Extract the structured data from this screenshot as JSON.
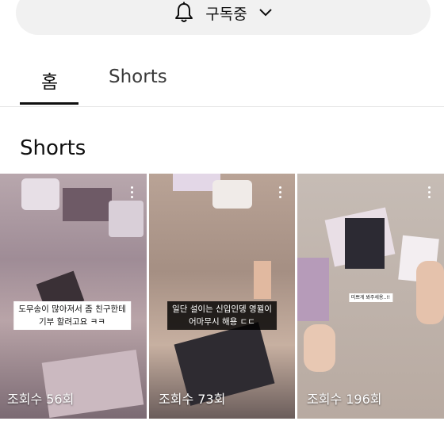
{
  "subscribe": {
    "label": "구독중",
    "bell_icon": "bell-icon",
    "chevron_icon": "chevron-down-icon"
  },
  "tabs": [
    {
      "label": "홈",
      "active": true
    },
    {
      "label": "Shorts",
      "active": false
    }
  ],
  "section": {
    "title": "Shorts"
  },
  "shorts": [
    {
      "caption_lines": [
        "도무송이 많아져서 좀 친구한테",
        "기부 할려고요 ㅋㅋ"
      ],
      "views": "조회수 56회"
    },
    {
      "caption_lines": [
        "일단 설이는 신입인뎅 영뀔이",
        "어마무시 해용 ㄷㄷ"
      ],
      "views": "조회수 73회"
    },
    {
      "caption_lines": [
        "미쁘게 봐주세용..!!"
      ],
      "views": "조회수 196회"
    }
  ],
  "colors": {
    "tab_underline": "#0f0f0f",
    "pill_bg": "#f1f1f1",
    "divider": "#e5e5e5"
  }
}
